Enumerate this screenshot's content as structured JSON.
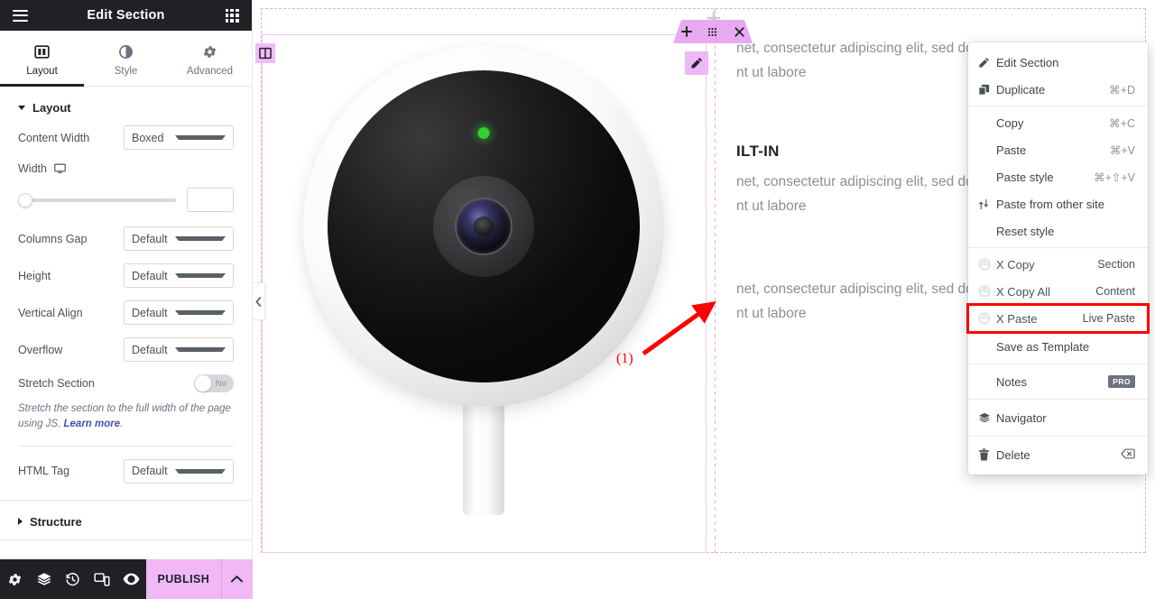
{
  "panel": {
    "header": {
      "title": "Edit Section",
      "menu_icon": "hamburger-icon",
      "widgets_icon": "grid-apps-icon"
    },
    "tabs": [
      {
        "label": "Layout",
        "icon": "layout-columns-icon",
        "active": true
      },
      {
        "label": "Style",
        "icon": "contrast-circle-icon",
        "active": false
      },
      {
        "label": "Advanced",
        "icon": "gear-icon",
        "active": false
      }
    ],
    "sections": [
      {
        "label": "Layout",
        "expanded": true
      },
      {
        "label": "Structure",
        "expanded": false
      }
    ],
    "controls": {
      "content_width": {
        "label": "Content Width",
        "value": "Boxed"
      },
      "width": {
        "label": "Width",
        "device_icon": "desktop-icon",
        "slider_value": 0,
        "input_value": ""
      },
      "columns_gap": {
        "label": "Columns Gap",
        "value": "Default"
      },
      "height": {
        "label": "Height",
        "value": "Default"
      },
      "vertical_align": {
        "label": "Vertical Align",
        "value": "Default"
      },
      "overflow": {
        "label": "Overflow",
        "value": "Default"
      },
      "stretch_section": {
        "label": "Stretch Section",
        "value": "No",
        "enabled": false
      },
      "stretch_desc_1": "Stretch the section to the full width of the page using JS. ",
      "stretch_desc_link": "Learn more",
      "stretch_desc_2": ".",
      "html_tag": {
        "label": "HTML Tag",
        "value": "Default"
      }
    },
    "footer": {
      "icons": [
        {
          "name": "settings-gear-icon"
        },
        {
          "name": "layers-navigator-icon"
        },
        {
          "name": "history-icon"
        },
        {
          "name": "responsive-mode-icon"
        },
        {
          "name": "preview-eye-icon"
        }
      ],
      "publish_label": "PUBLISH",
      "publish_arrow_icon": "chevron-up-icon"
    }
  },
  "canvas": {
    "collapse_icon": "chevron-left-icon",
    "section_handle": {
      "add_icon": "plus-icon",
      "drag_icon": "drag-dots-icon",
      "close_icon": "close-x-icon"
    },
    "column_handle_icon": "column-layout-icon",
    "widget_edit_icon": "pencil-edit-icon",
    "image": {
      "name": "security-camera-image",
      "led_color": "#2fd02f"
    },
    "content": [
      {
        "heading": "",
        "body": "net, consectetur adipiscing elit, sed do\nnt ut labore"
      },
      {
        "heading": "ILT-IN",
        "body": "net, consectetur adipiscing elit, sed do\nnt ut labore"
      },
      {
        "heading": "",
        "body": "net, consectetur adipiscing elit, sed do\nnt ut labore"
      }
    ]
  },
  "context_menu": {
    "groups": [
      {
        "items": [
          {
            "label": "Edit Section",
            "shortcut": "",
            "icon": "pencil-edit-icon"
          },
          {
            "label": "Duplicate",
            "shortcut": "⌘+D",
            "icon": "duplicate-copy-icon"
          }
        ]
      },
      {
        "items": [
          {
            "label": "Copy",
            "shortcut": "⌘+C",
            "icon": ""
          },
          {
            "label": "Paste",
            "shortcut": "⌘+V",
            "icon": ""
          },
          {
            "label": "Paste style",
            "shortcut": "⌘+⇧+V",
            "icon": ""
          },
          {
            "label": "Paste from other site",
            "shortcut": "",
            "icon": "transfer-arrows-icon"
          },
          {
            "label": "Reset style",
            "shortcut": "",
            "icon": ""
          }
        ]
      },
      {
        "items": [
          {
            "label": "X Copy",
            "shortcut": "Section",
            "icon": "x-plugin-icon"
          },
          {
            "label": "X Copy All",
            "shortcut": "Content",
            "icon": "x-plugin-icon"
          },
          {
            "label": "X Paste",
            "shortcut": "Live Paste",
            "icon": "x-plugin-icon",
            "highlighted": true
          },
          {
            "label": "Save as Template",
            "shortcut": "",
            "icon": ""
          }
        ]
      },
      {
        "items": [
          {
            "label": "Notes",
            "shortcut": "PRO",
            "icon": "",
            "badge": true
          }
        ]
      },
      {
        "items": [
          {
            "label": "Navigator",
            "shortcut": "",
            "icon": "layers-navigator-icon"
          }
        ]
      },
      {
        "items": [
          {
            "label": "Delete",
            "shortcut": "",
            "icon": "trash-delete-icon",
            "end_icon": "delete-key-icon"
          }
        ]
      }
    ]
  },
  "annotation": {
    "label": "(1)",
    "color": "#fe0000",
    "target": "X Paste"
  }
}
